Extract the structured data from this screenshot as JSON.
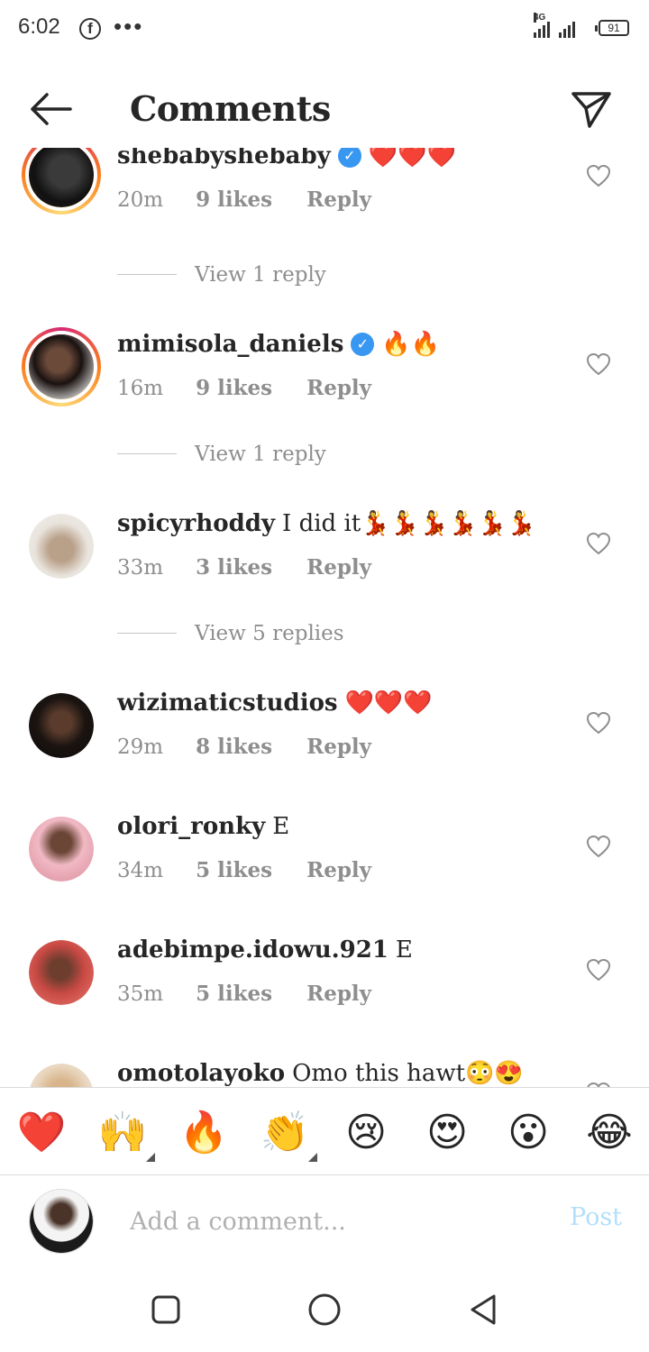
{
  "status_bar": {
    "time": "6:02",
    "network": "4G",
    "battery": "91"
  },
  "header": {
    "title": "Comments"
  },
  "comments": [
    {
      "username": "shebabyshebaby",
      "verified": true,
      "text": "❤️❤️❤️",
      "time": "20m",
      "likes": "9 likes",
      "reply": "Reply",
      "view_replies": "View 1 reply",
      "story_ring": true
    },
    {
      "username": "mimisola_daniels",
      "verified": true,
      "text": "🔥🔥",
      "time": "16m",
      "likes": "9 likes",
      "reply": "Reply",
      "view_replies": "View 1 reply",
      "story_ring": true
    },
    {
      "username": "spicyrhoddy",
      "verified": false,
      "text": "I did it💃💃💃💃💃💃",
      "time": "33m",
      "likes": "3 likes",
      "reply": "Reply",
      "view_replies": "View 5 replies",
      "story_ring": false
    },
    {
      "username": "wizimaticstudios",
      "verified": false,
      "text": "❤️❤️❤️",
      "time": "29m",
      "likes": "8 likes",
      "reply": "Reply",
      "story_ring": false
    },
    {
      "username": "olori_ronky",
      "verified": false,
      "text": "E",
      "time": "34m",
      "likes": "5 likes",
      "reply": "Reply",
      "story_ring": false
    },
    {
      "username": "adebimpe.idowu.921",
      "verified": false,
      "text": "E",
      "time": "35m",
      "likes": "5 likes",
      "reply": "Reply",
      "story_ring": false
    },
    {
      "username": "omotolayoko",
      "verified": false,
      "text": "Omo this hawt😳😍",
      "time": "",
      "likes": "",
      "reply": "",
      "story_ring": false
    }
  ],
  "emoji_bar": [
    "❤️",
    "🙌",
    "🔥",
    "👏",
    "😢",
    "😍",
    "😮",
    "😂"
  ],
  "compose": {
    "placeholder": "Add a comment...",
    "post_label": "Post"
  },
  "colors": {
    "accent": "#3897f0",
    "post_disabled": "#b2dffc",
    "meta_gray": "#8e8e8e",
    "text": "#262626"
  },
  "icons": {
    "back": "arrow-left-icon",
    "share": "paper-plane-icon",
    "like": "heart-outline-icon",
    "verified": "verified-badge-icon"
  }
}
